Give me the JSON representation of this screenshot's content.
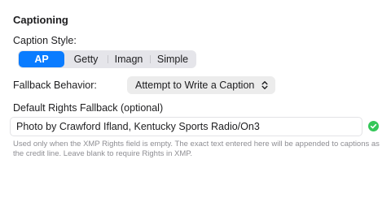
{
  "section": {
    "title": "Captioning"
  },
  "caption_style": {
    "label": "Caption Style:",
    "options": [
      "AP",
      "Getty",
      "Imagn",
      "Simple"
    ],
    "selected": "AP"
  },
  "fallback_behavior": {
    "label": "Fallback Behavior:",
    "value": "Attempt to Write a Caption",
    "icon": "chevron-up-down-icon"
  },
  "default_rights": {
    "label": "Default Rights Fallback (optional)",
    "value": "Photo by Crawford Ifland, Kentucky Sports Radio/On3",
    "status_icon": "checkmark-circle-icon",
    "help": "Used only when the XMP Rights field is empty. The exact text entered here will be appended to captions as the credit line. Leave blank to require Rights in XMP."
  },
  "colors": {
    "accent": "#0a7cff",
    "success": "#34c759",
    "secondary_text": "#8e8e93"
  }
}
